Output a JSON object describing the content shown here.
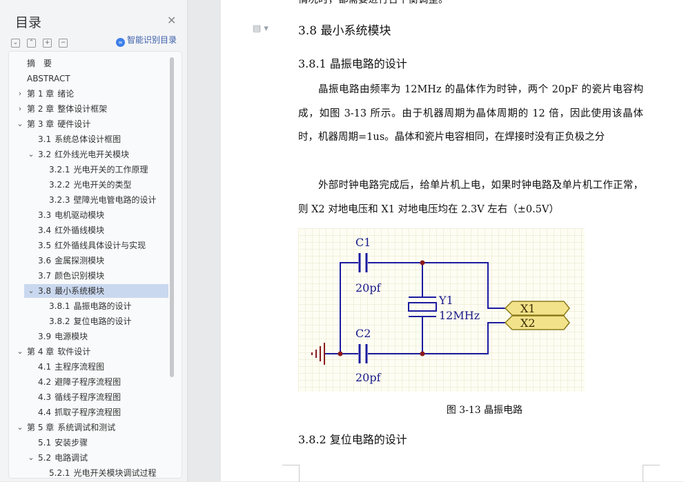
{
  "sidebar": {
    "title": "目录",
    "smart_toc_label": "智能识别目录",
    "tool_icons": [
      "collapse-all-icon",
      "expand-all-icon",
      "add-icon",
      "remove-icon"
    ],
    "items": [
      {
        "num": "",
        "label": "摘　要",
        "level": 0,
        "caret": ""
      },
      {
        "num": "",
        "label": "ABSTRACT",
        "level": 0,
        "caret": ""
      },
      {
        "num": "第 1 章",
        "label": "绪论",
        "level": 0,
        "caret": "›"
      },
      {
        "num": "第 2 章",
        "label": "整体设计框架",
        "level": 0,
        "caret": "›"
      },
      {
        "num": "第 3 章",
        "label": "硬件设计",
        "level": 0,
        "caret": "⌄"
      },
      {
        "num": "3.1",
        "label": "系统总体设计框图",
        "level": 1,
        "caret": ""
      },
      {
        "num": "3.2",
        "label": "红外线光电开关模块",
        "level": 1,
        "caret": "⌄"
      },
      {
        "num": "3.2.1",
        "label": "光电开关的工作原理",
        "level": 2,
        "caret": ""
      },
      {
        "num": "3.2.2",
        "label": "光电开关的类型",
        "level": 2,
        "caret": ""
      },
      {
        "num": "3.2.3",
        "label": "壁障光电管电路的设计",
        "level": 2,
        "caret": ""
      },
      {
        "num": "3.3",
        "label": "电机驱动模块",
        "level": 1,
        "caret": ""
      },
      {
        "num": "3.4",
        "label": "红外循线模块",
        "level": 1,
        "caret": ""
      },
      {
        "num": "3.5",
        "label": "红外循线具体设计与实现",
        "level": 1,
        "caret": ""
      },
      {
        "num": "3.6",
        "label": "金属探测模块",
        "level": 1,
        "caret": ""
      },
      {
        "num": "3.7",
        "label": "颜色识别模块",
        "level": 1,
        "caret": ""
      },
      {
        "num": "3.8",
        "label": "最小系统模块",
        "level": 1,
        "caret": "⌄",
        "active": true
      },
      {
        "num": "3.8.1",
        "label": "晶振电路的设计",
        "level": 2,
        "caret": ""
      },
      {
        "num": "3.8.2",
        "label": "复位电路的设计",
        "level": 2,
        "caret": ""
      },
      {
        "num": "3.9",
        "label": "电源模块",
        "level": 1,
        "caret": ""
      },
      {
        "num": "第 4 章",
        "label": "软件设计",
        "level": 0,
        "caret": "⌄"
      },
      {
        "num": "4.1",
        "label": "主程序流程图",
        "level": 1,
        "caret": ""
      },
      {
        "num": "4.2",
        "label": "避障子程序流程图",
        "level": 1,
        "caret": ""
      },
      {
        "num": "4.3",
        "label": "循线子程序流程图",
        "level": 1,
        "caret": ""
      },
      {
        "num": "4.4",
        "label": "抓取子程序流程图",
        "level": 1,
        "caret": ""
      },
      {
        "num": "第 5 章",
        "label": "系统调试和测试",
        "level": 0,
        "caret": "⌄"
      },
      {
        "num": "5.1",
        "label": "安装步骤",
        "level": 1,
        "caret": ""
      },
      {
        "num": "5.2",
        "label": "电路调试",
        "level": 1,
        "caret": "⌄"
      },
      {
        "num": "5.2.1",
        "label": "光电开关模块调试过程",
        "level": 2,
        "caret": ""
      }
    ]
  },
  "document": {
    "top_cut_text": "情况时，都需要进行合平衡调整。",
    "section_heading": "3.8  最小系统模块",
    "subsection1_heading": "3.8.1  晶振电路的设计",
    "para1": "晶振电路由频率为 12MHz 的晶体作为时钟，两个 20pF 的瓷片电容构成，如图 3-13 所示。由于机器周期为晶体周期的 12 倍，因此使用该晶体时，机器周期=1us。晶体和瓷片电容相同，在焊接时没有正负极之分",
    "para2": "外部时钟电路完成后，给单片机上电，如果时钟电路及单片机工作正常，则 X2 对地电压和 X1 对地电压均在 2.3V 左右（±0.5V）",
    "figure_caption": "图 3-13  晶振电路",
    "subsection2_heading": "3.8.2  复位电路的设计"
  },
  "circuit": {
    "c1_label": "C1",
    "c1_value": "20pf",
    "c2_label": "C2",
    "c2_value": "20pf",
    "crystal_label": "Y1",
    "crystal_value": "12MHz",
    "port1": "X1",
    "port2": "X2",
    "wire_color": "#1a1aa0",
    "node_color": "#8b1a1a",
    "ground_color": "#8b1a1a",
    "port_fill": "#f2e28a"
  }
}
